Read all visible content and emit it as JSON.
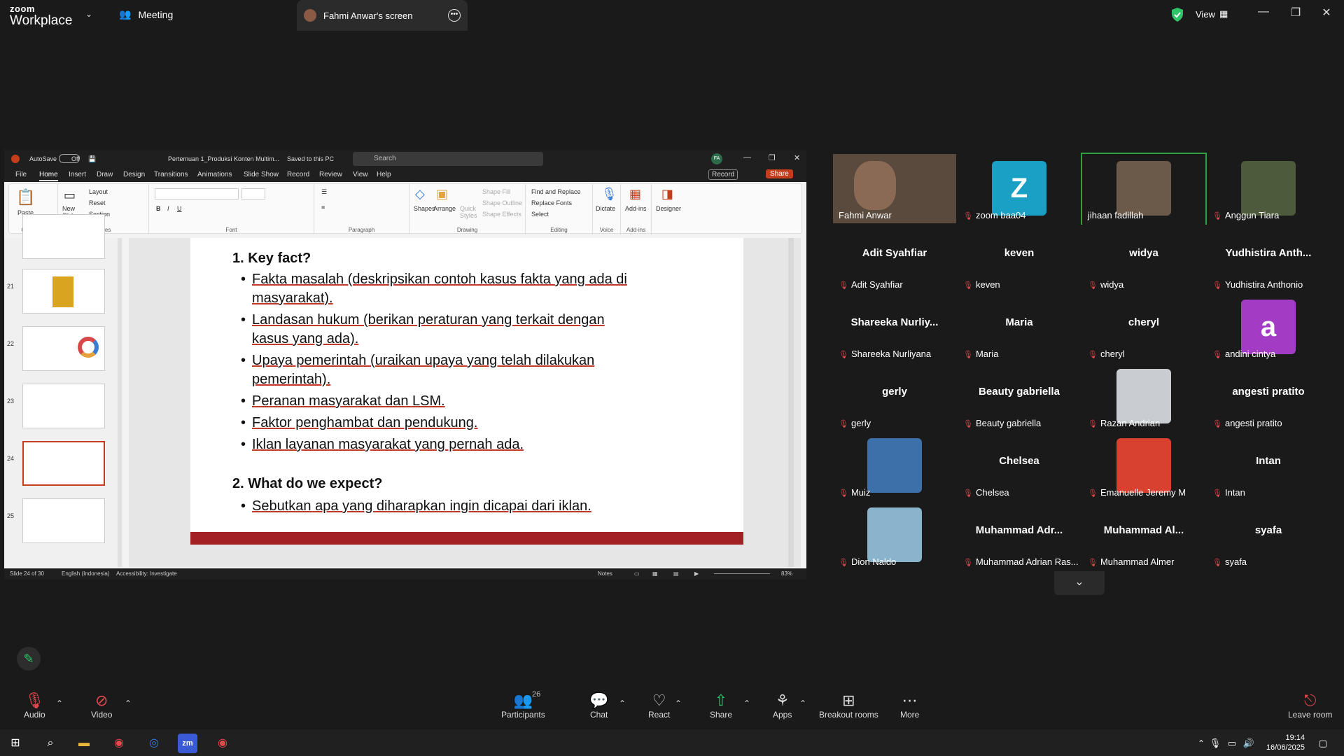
{
  "topbar": {
    "logo_line1": "zoom",
    "logo_line2": "Workplace",
    "meeting_label": "Meeting",
    "screen_tab_label": "Fahmi Anwar's screen",
    "view_label": "View"
  },
  "ppt": {
    "autosave_label": "AutoSave",
    "autosave_state": "Off",
    "file_title": "Pertemuan 1_Produksi Konten Multim...",
    "saved_state": "Saved to this PC",
    "search_placeholder": "Search",
    "user_initials": "FA",
    "menu": [
      "File",
      "Home",
      "Insert",
      "Draw",
      "Design",
      "Transitions",
      "Animations",
      "Slide Show",
      "Record",
      "Review",
      "View",
      "Help"
    ],
    "record_btn": "Record",
    "share_btn": "Share",
    "ribbon": {
      "paste": "Paste",
      "new_slide": "New Slide",
      "layout": "Layout",
      "reset": "Reset",
      "section": "Section",
      "shapes": "Shapes",
      "arrange": "Arrange",
      "quick_styles": "Quick Styles",
      "shape_fill": "Shape Fill",
      "shape_outline": "Shape Outline",
      "shape_effects": "Shape Effects",
      "find_replace": "Find and Replace",
      "replace_fonts": "Replace Fonts",
      "select": "Select",
      "dictate": "Dictate",
      "addins": "Add-ins",
      "designer": "Designer",
      "groups": [
        "Clipboard",
        "Slides",
        "Font",
        "Paragraph",
        "Drawing",
        "Editing",
        "Voice",
        "Add-ins"
      ]
    },
    "thumbs": [
      "21",
      "22",
      "23",
      "24",
      "25"
    ],
    "slide": {
      "h1": "1.   Key fact?",
      "b1a": "Fakta masalah (deskripsikan contoh kasus fakta yang ada di",
      "b1b": "masyarakat).",
      "b2a": "Landasan hukum (berikan peraturan yang terkait dengan",
      "b2b": "kasus yang ada).",
      "b3a": "Upaya pemerintah  (uraikan upaya yang telah dilakukan",
      "b3b": "pemerintah).",
      "b4": "Peranan masyarakat dan LSM.",
      "b5": "Faktor penghambat dan pendukung.",
      "b6": "Iklan layanan masyarakat yang pernah ada.",
      "h2": "2.   What do we expect?",
      "b7": "Sebutkan apa yang diharapkan ingin dicapai dari iklan."
    },
    "status": {
      "slide_count": "Slide 24 of 30",
      "language": "English (Indonesia)",
      "accessibility": "Accessibility: Investigate",
      "notes": "Notes",
      "zoom": "83%"
    }
  },
  "gallery": {
    "tiles": [
      {
        "label": "Fahmi Anwar",
        "big": "",
        "kind": "photo",
        "color": "#5a4a3e",
        "muted": false
      },
      {
        "label": "zoom baa04",
        "big": "Z",
        "kind": "letter",
        "color": "#1aa0c4",
        "muted": true
      },
      {
        "label": "jihaan fadillah",
        "big": "",
        "kind": "avatar",
        "color": "#6b5a4a",
        "muted": false
      },
      {
        "label": "Anggun Tiara",
        "big": "",
        "kind": "avatar",
        "color": "#4d5a3c",
        "muted": true
      },
      {
        "label": "Adit Syahfiar",
        "big": "Adit Syahfiar",
        "kind": "text",
        "color": "",
        "muted": true
      },
      {
        "label": "keven",
        "big": "keven",
        "kind": "text",
        "color": "",
        "muted": true
      },
      {
        "label": "widya",
        "big": "widya",
        "kind": "text",
        "color": "",
        "muted": true
      },
      {
        "label": "Yudhistira Anthonio",
        "big": "Yudhistira Anth...",
        "kind": "text",
        "color": "",
        "muted": true
      },
      {
        "label": "Shareeka Nurliyana",
        "big": "Shareeka Nurliy...",
        "kind": "text",
        "color": "",
        "muted": true
      },
      {
        "label": "Maria",
        "big": "Maria",
        "kind": "text",
        "color": "",
        "muted": true
      },
      {
        "label": "cheryl",
        "big": "cheryl",
        "kind": "text",
        "color": "",
        "muted": true
      },
      {
        "label": "andini cintya",
        "big": "a",
        "kind": "letter",
        "color": "#a23cc4",
        "muted": true
      },
      {
        "label": "gerly",
        "big": "gerly",
        "kind": "text",
        "color": "",
        "muted": true
      },
      {
        "label": "Beauty gabriella",
        "big": "Beauty gabriella",
        "kind": "text",
        "color": "",
        "muted": true
      },
      {
        "label": "Razan Andrian",
        "big": "",
        "kind": "avatar",
        "color": "#c9ccd0",
        "muted": true
      },
      {
        "label": "angesti pratito",
        "big": "angesti pratito",
        "kind": "text",
        "color": "",
        "muted": true
      },
      {
        "label": "Muiz",
        "big": "",
        "kind": "avatar",
        "color": "#3d6fa8",
        "muted": true
      },
      {
        "label": "Chelsea",
        "big": "Chelsea",
        "kind": "text",
        "color": "",
        "muted": true
      },
      {
        "label": "Emanuelle Jeremy M",
        "big": "",
        "kind": "avatar",
        "color": "#d8412f",
        "muted": true
      },
      {
        "label": "Intan",
        "big": "Intan",
        "kind": "text",
        "color": "",
        "muted": true
      },
      {
        "label": "Dion Naldo",
        "big": "",
        "kind": "avatar",
        "color": "#8ab4cc",
        "muted": true
      },
      {
        "label": "Muhammad Adrian Ras...",
        "big": "Muhammad  Adr...",
        "kind": "text",
        "color": "",
        "muted": true
      },
      {
        "label": "Muhammad Almer",
        "big": "Muhammad  Al...",
        "kind": "text",
        "color": "",
        "muted": true
      },
      {
        "label": "syafa",
        "big": "syafa",
        "kind": "text",
        "color": "",
        "muted": true
      }
    ]
  },
  "toolbar": {
    "audio": "Audio",
    "video": "Video",
    "participants": "Participants",
    "participants_count": "26",
    "chat": "Chat",
    "react": "React",
    "share": "Share",
    "apps": "Apps",
    "breakout": "Breakout rooms",
    "more": "More",
    "leave": "Leave room"
  },
  "taskbar": {
    "time": "19:14",
    "date": "16/06/2025"
  },
  "colors": {
    "zoom_bg": "#1a1a1a",
    "accent_green": "#2ea043",
    "share_green": "#1fcf6a",
    "slide_band": "#a32025",
    "mic_muted": "#e5484d"
  }
}
